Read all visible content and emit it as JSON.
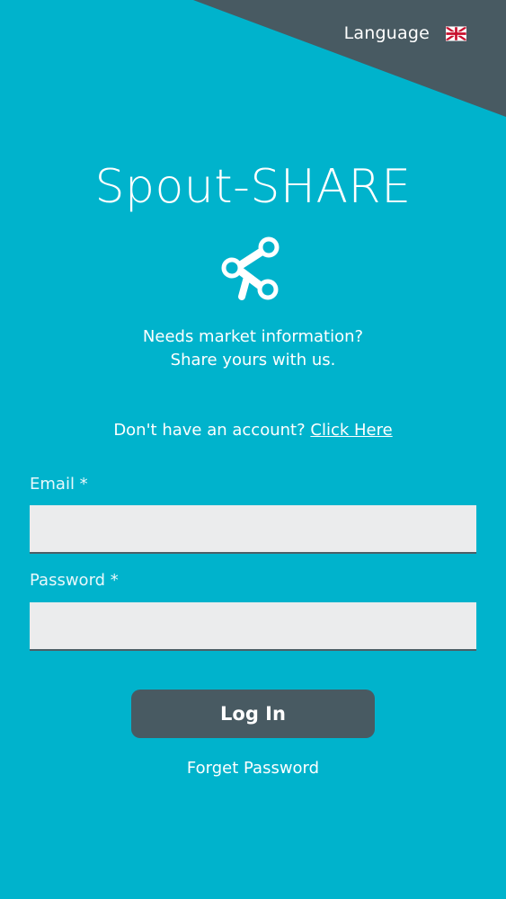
{
  "language": {
    "label": "Language",
    "flag_icon": "uk-flag-icon"
  },
  "app": {
    "title": "Spout-SHARE",
    "logo_icon": "share-icon"
  },
  "tagline": {
    "line1": "Needs market information?",
    "line2": "Share yours with us."
  },
  "signup": {
    "prompt": "Don't have an account?",
    "link_label": "Click Here"
  },
  "form": {
    "email_label": "Email *",
    "email_value": "",
    "password_label": "Password *",
    "password_value": ""
  },
  "actions": {
    "login_label": "Log In",
    "forgot_label": "Forget Password"
  },
  "colors": {
    "background": "#00b3cc",
    "corner": "#485a62",
    "button": "#485a62",
    "input_background": "#ebeced"
  }
}
